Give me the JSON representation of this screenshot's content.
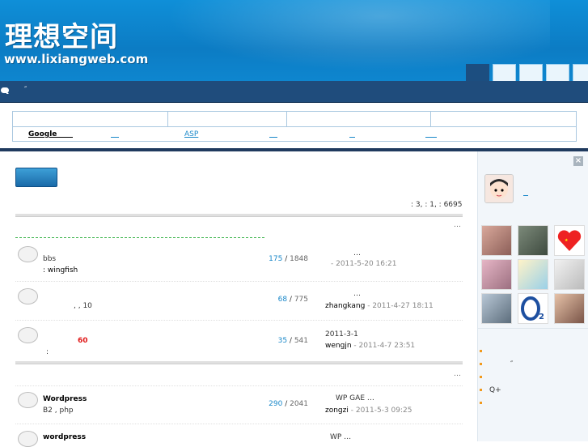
{
  "header": {
    "logo_cn": "理想空间",
    "logo_url": "www.lixiangweb.com",
    "nav_marquee": "″"
  },
  "links": [
    {
      "label": "Google"
    },
    {
      "label": "ASP"
    }
  ],
  "stats": ": 3,  : 1,  : 6695",
  "more_label": "…",
  "threads_group1": [
    {
      "title": "",
      "line2": "bbs",
      "line3": ": wingfish",
      "replies": "175",
      "views": "1848",
      "last_title": "…",
      "who": "",
      "when": "- 2011-5-20 16:21"
    },
    {
      "title": "",
      "line2": ",  , 10",
      "line3": "",
      "replies": "68",
      "views": "775",
      "last_title": "…",
      "who": "zhangkang",
      "when": " - 2011-4-27 18:11"
    },
    {
      "title": "60",
      "line2": ":",
      "line3": "",
      "replies": "35",
      "views": "541",
      "last_title": "2011-3-1",
      "who": "wengjn",
      "when": " - 2011-4-7 23:51"
    }
  ],
  "threads_group2": [
    {
      "title": "Wordpress",
      "line2": "B2       ,       php",
      "replies": "290",
      "views": "2041",
      "last_title": "WP     GAE …",
      "who": "zongzi",
      "when": " - 2011-5-3 09:25"
    },
    {
      "title": "wordpress",
      "line2": "",
      "replies": "",
      "views": "",
      "last_title": "WP          …",
      "who": "",
      "when": ""
    }
  ],
  "sidebar": {
    "close_label": "×",
    "list": [
      {
        "text": ""
      },
      {
        "text": "″"
      },
      {
        "text": ""
      },
      {
        "text": "Q+"
      },
      {
        "text": ""
      }
    ]
  },
  "colors": {
    "banner": "#0c7cc4",
    "navbar": "#1f4c7c",
    "link": "#1a88c9",
    "hot": "#e01818"
  }
}
